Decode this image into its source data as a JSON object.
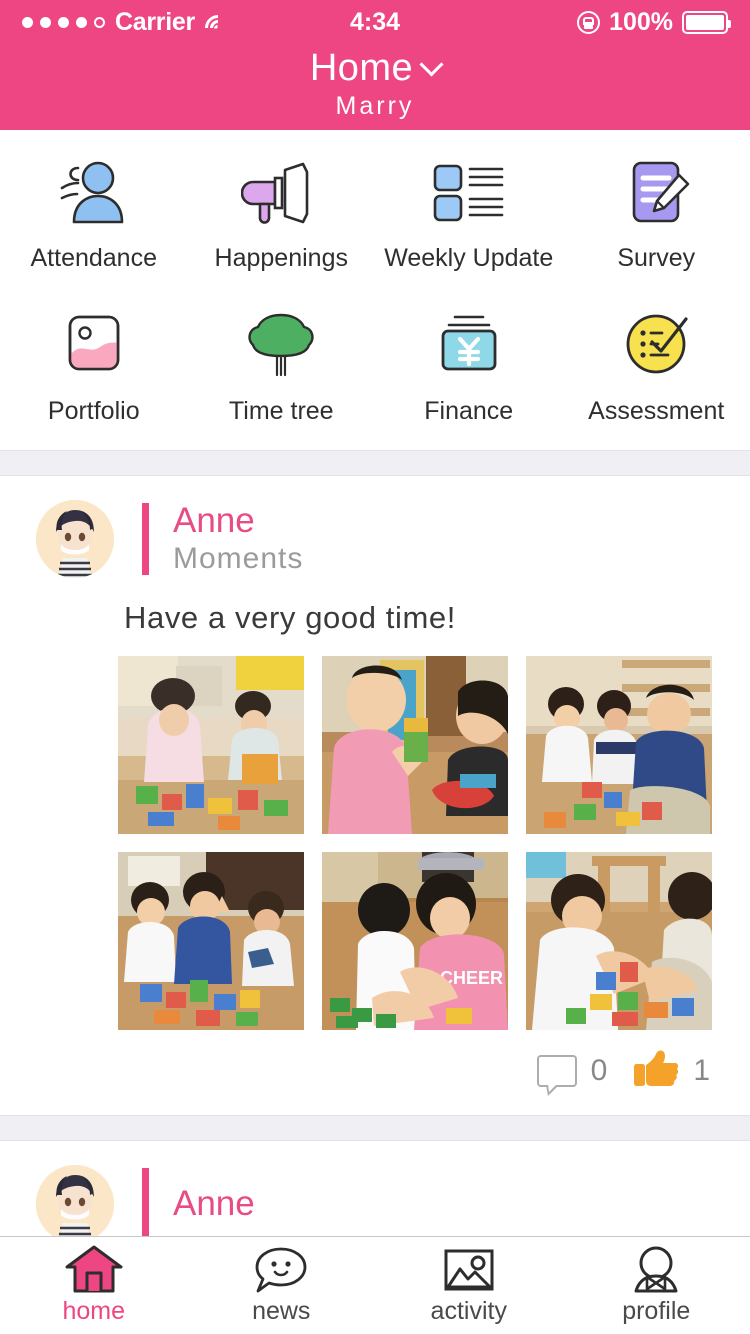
{
  "status_bar": {
    "carrier": "Carrier",
    "signal_dots_filled": 4,
    "signal_dots_total": 5,
    "wifi_icon": "wifi-icon",
    "time": "4:34",
    "rotation_lock_icon": "rotation-lock-icon",
    "battery_percent": "100%",
    "battery_icon": "battery-full-icon"
  },
  "navbar": {
    "title": "Home",
    "chevron_icon": "chevron-down-icon",
    "subtitle": "Marry",
    "background_color": "#ED4682"
  },
  "shortcuts": {
    "rows": [
      [
        {
          "label": "Attendance",
          "icon": "person-attendance-icon",
          "color": "#8EC0F2"
        },
        {
          "label": "Happenings",
          "icon": "megaphone-icon",
          "color": "#DDA7ED"
        },
        {
          "label": "Weekly Update",
          "icon": "list-squares-icon",
          "color": "#9CC9F5"
        },
        {
          "label": "Survey",
          "icon": "document-pencil-icon",
          "color": "#A899F0"
        }
      ],
      [
        {
          "label": "Portfolio",
          "icon": "photo-frame-icon",
          "color": "#F9A8C0"
        },
        {
          "label": "Time tree",
          "icon": "tree-icon",
          "color": "#4CAF62"
        },
        {
          "label": "Finance",
          "icon": "yen-card-icon",
          "color": "#8FD8E8"
        },
        {
          "label": "Assessment",
          "icon": "checklist-circle-icon",
          "color": "#F7E14E"
        }
      ]
    ]
  },
  "feed": {
    "posts": [
      {
        "avatar_icon": "avatar-anime-boy",
        "author": "Anne",
        "subtitle": "Moments",
        "text": "Have a very good time!",
        "photos": [
          {
            "alt": "children-building-blocks-classroom-1"
          },
          {
            "alt": "boy-pink-shirt-holding-block-2"
          },
          {
            "alt": "three-children-playing-blocks-3"
          },
          {
            "alt": "three-children-posing-peace-sign-4"
          },
          {
            "alt": "girls-sorting-green-blocks-5"
          },
          {
            "alt": "boys-stacking-blocks-floor-6"
          }
        ],
        "comment_icon": "comment-bubble-icon",
        "comment_count": "0",
        "like_icon": "thumbs-up-icon",
        "like_count": "1"
      },
      {
        "avatar_icon": "avatar-anime-boy",
        "author": "Anne",
        "subtitle": "",
        "text": "",
        "photos": [],
        "comment_icon": "comment-bubble-icon",
        "comment_count": "",
        "like_icon": "thumbs-up-icon",
        "like_count": ""
      }
    ]
  },
  "tabbar": {
    "items": [
      {
        "label": "home",
        "icon": "home-icon",
        "active": true
      },
      {
        "label": "news",
        "icon": "smiley-chat-icon",
        "active": false
      },
      {
        "label": "activity",
        "icon": "image-icon",
        "active": false
      },
      {
        "label": "profile",
        "icon": "person-bowtie-icon",
        "active": false
      }
    ],
    "active_color": "#ED4682"
  }
}
